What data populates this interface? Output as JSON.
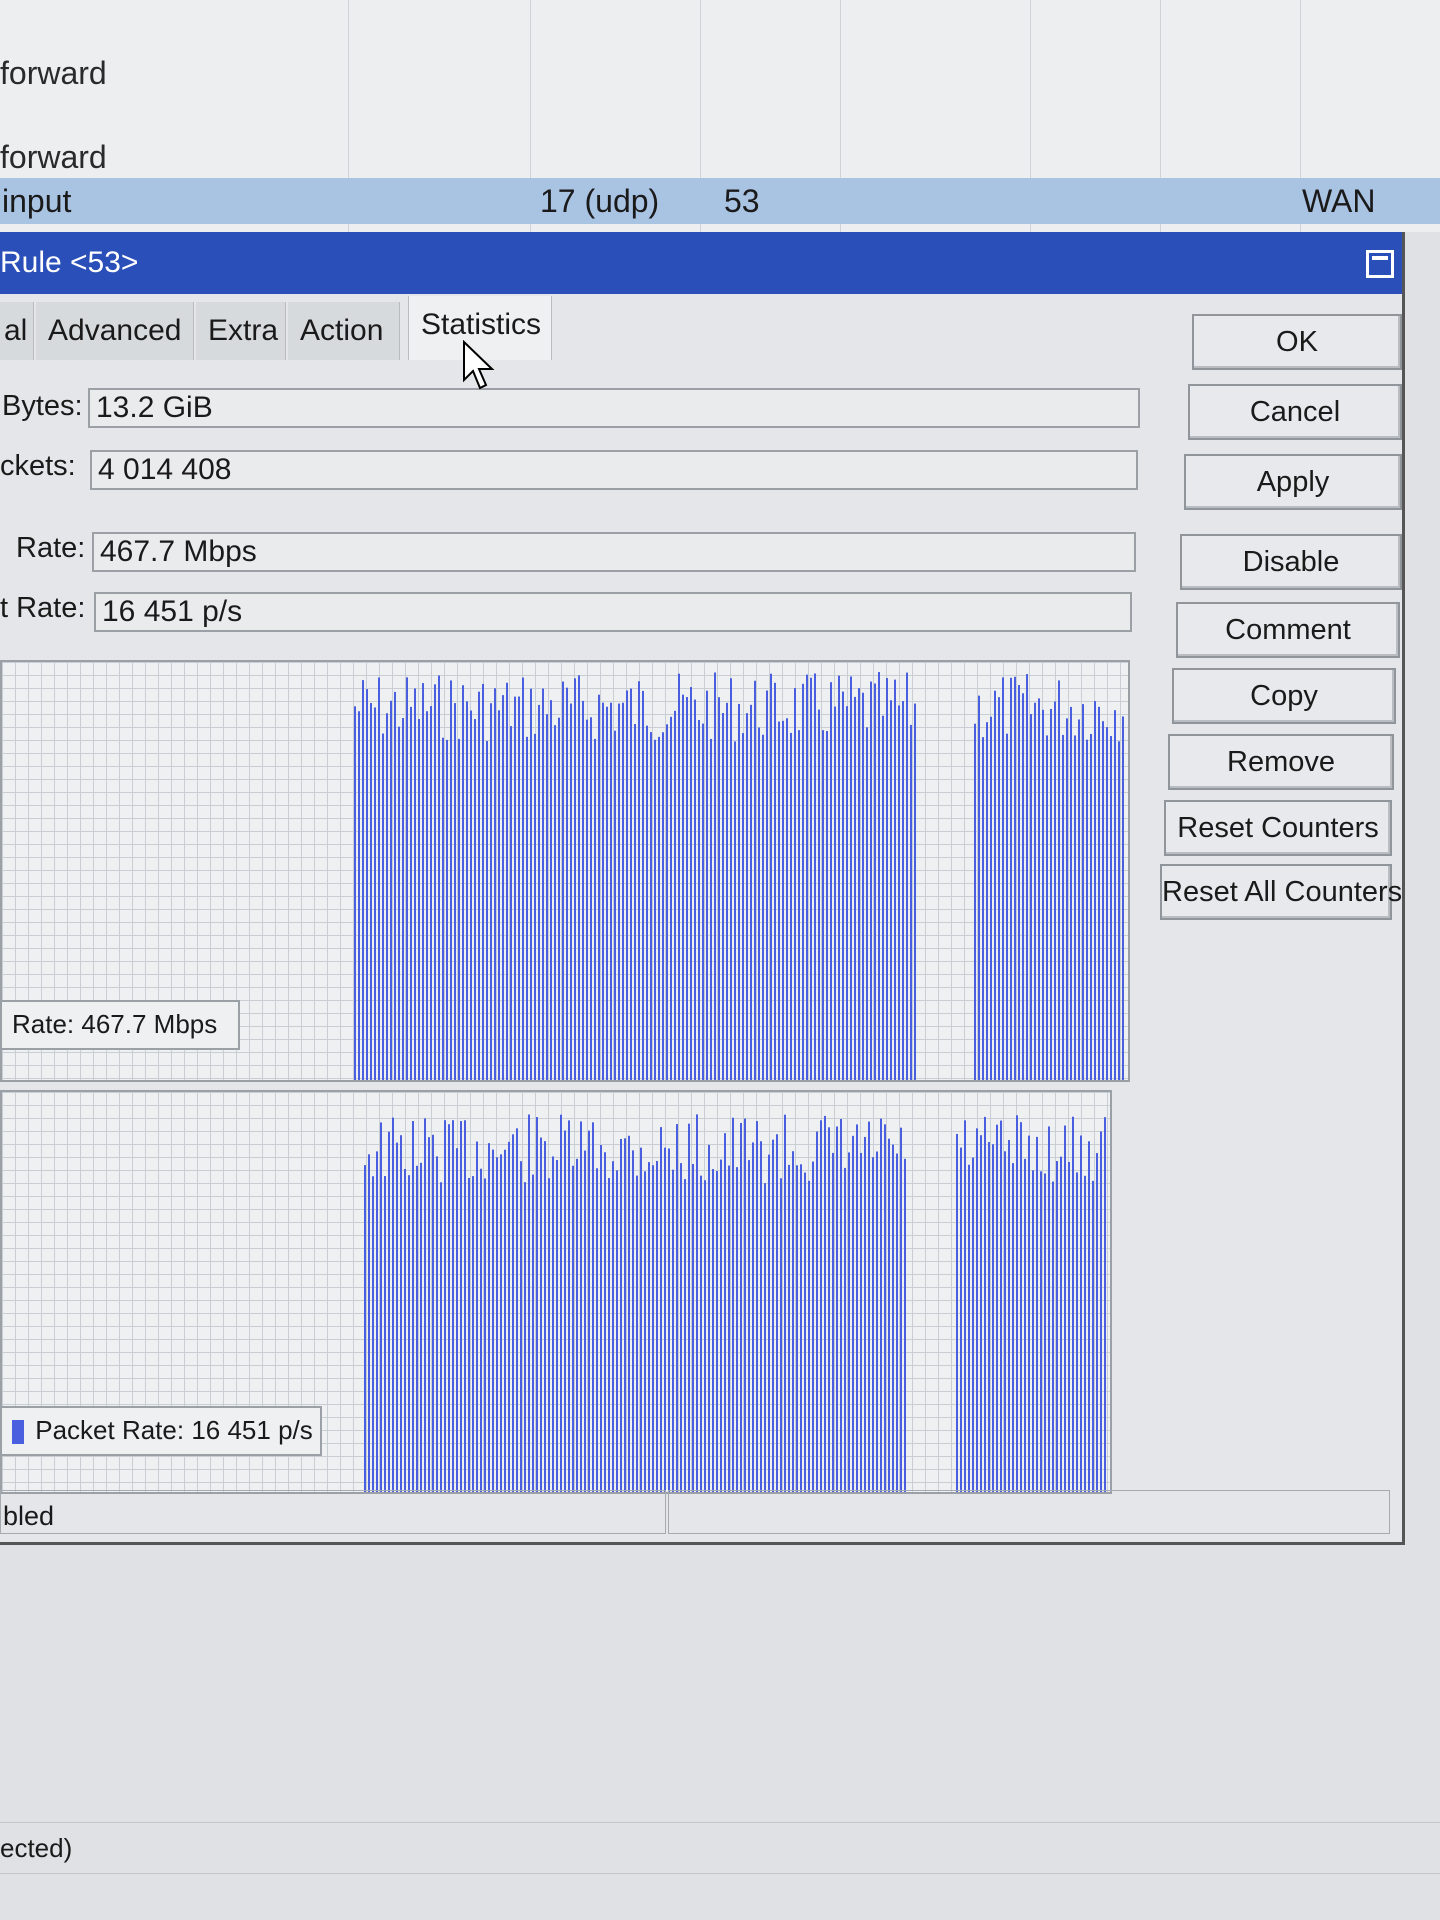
{
  "rule_list": {
    "rows": [
      {
        "chain": "forward",
        "protocol": "",
        "port": "",
        "interface": ""
      },
      {
        "chain": "forward",
        "protocol": "",
        "port": "",
        "interface": ""
      },
      {
        "chain": "input",
        "protocol": "17 (udp)",
        "port": "53",
        "interface": "WAN"
      }
    ]
  },
  "dialog": {
    "title": "Rule <53>",
    "tabs": [
      "al",
      "Advanced",
      "Extra",
      "Action",
      "Statistics"
    ],
    "active_tab": "Statistics",
    "fields": {
      "bytes_label": "Bytes:",
      "bytes_value": "13.2 GiB",
      "packets_label": "ckets:",
      "packets_value": "4 014 408",
      "rate_label": "Rate:",
      "rate_value": "467.7 Mbps",
      "packet_rate_label": "t Rate:",
      "packet_rate_value": "16 451 p/s"
    },
    "graphs": {
      "rate_legend_label": "Rate:",
      "rate_legend_value": "467.7 Mbps",
      "packet_rate_legend_label": "Packet Rate:",
      "packet_rate_legend_value": "16 451 p/s",
      "bar_color": "#4a5fe0"
    },
    "buttons": {
      "ok": "OK",
      "cancel": "Cancel",
      "apply": "Apply",
      "disable": "Disable",
      "comment": "Comment",
      "copy": "Copy",
      "remove": "Remove",
      "reset_counters": "Reset Counters",
      "reset_all_counters": "Reset All Counters"
    },
    "status_left": "bled"
  },
  "bottom_status": "ected)",
  "colors": {
    "titlebar": "#2a4fb8",
    "selected_row": "#a9c3e3"
  }
}
